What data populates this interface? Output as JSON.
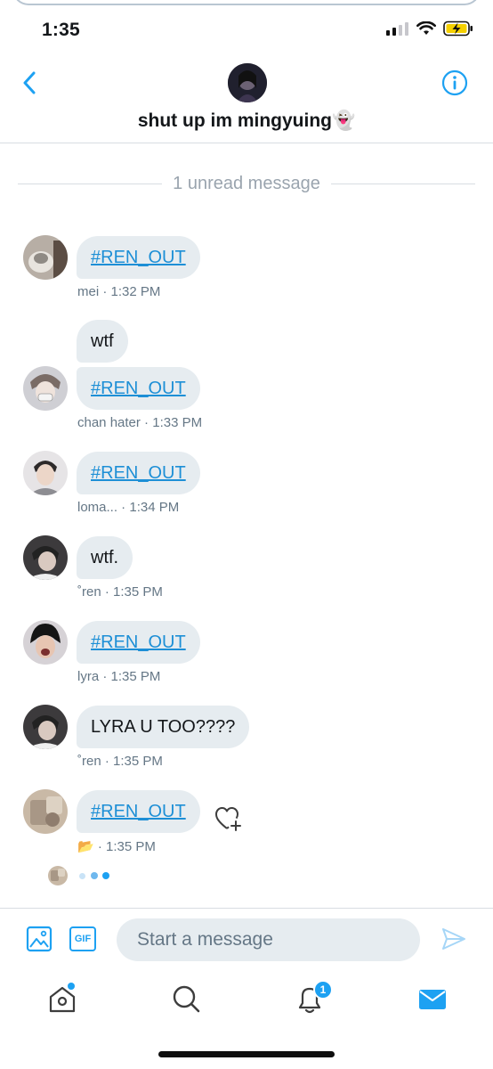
{
  "status_bar": {
    "time": "1:35"
  },
  "header": {
    "title": "shut up im mingyuing👻"
  },
  "divider": {
    "label": "1 unread message"
  },
  "messages": [
    {
      "text": "#REN_OUT",
      "author": "mei",
      "time": "1:32 PM"
    },
    {
      "text_1": "wtf",
      "text_2": "#REN_OUT",
      "author": "chan hater",
      "time": "1:33 PM"
    },
    {
      "text": "#REN_OUT",
      "author": "loma...",
      "time": "1:34 PM"
    },
    {
      "text": "wtf.",
      "author": "ren",
      "author_mark": "˚",
      "time": "1:35 PM"
    },
    {
      "text": "#REN_OUT",
      "author": "lyra",
      "time": "1:35 PM"
    },
    {
      "text": "LYRA U TOO????",
      "author": "ren",
      "author_mark": "˚",
      "time": "1:35 PM"
    },
    {
      "text": "#REN_OUT",
      "author": "📂",
      "time": "1:35 PM"
    }
  ],
  "meta_separator": " · ",
  "composer": {
    "placeholder": "Start a message",
    "gif_label": "GIF"
  },
  "tabbar": {
    "notifications_badge": "1"
  },
  "colors": {
    "accent": "#1da1f2",
    "bubble": "#e6ecf0",
    "link": "#1d8fd6"
  }
}
